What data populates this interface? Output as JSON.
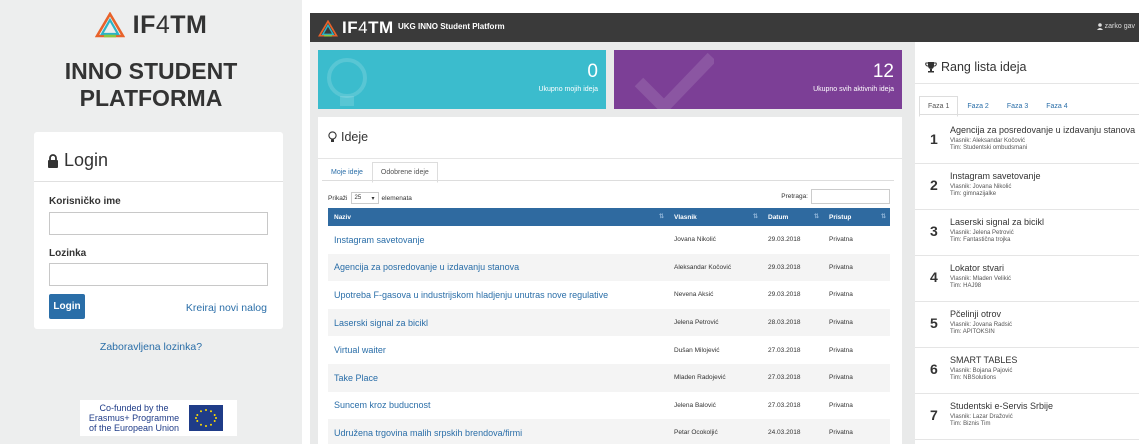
{
  "brand": {
    "logo_text_a": "IF",
    "logo_text_b": "4",
    "logo_text_c": "TM"
  },
  "left": {
    "title_line1": "INNO STUDENT",
    "title_line2": "PLATFORMA",
    "login": {
      "heading": "Login",
      "username_label": "Korisničko ime",
      "username_value": "",
      "password_label": "Lozinka",
      "password_value": "",
      "submit_label": "Login",
      "register_link": "Kreiraj novi nalog"
    },
    "forgot_link": "Zaboravljena lozinka?",
    "eu_line1": "Co-funded by the",
    "eu_line2": "Erasmus+ Programme",
    "eu_line3": "of the European Union"
  },
  "navbar": {
    "subtitle": "UKG INNO Student Platform",
    "user": "zarko gav"
  },
  "tiles": {
    "my": {
      "number": "0",
      "caption": "Ukupno mojih ideja"
    },
    "all": {
      "number": "12",
      "caption": "Ukupno svih aktivnih ideja"
    }
  },
  "ideas": {
    "heading": "Ideje",
    "tabs": [
      "Moje ideje",
      "Odobrene ideje"
    ],
    "length_prefix": "Prikaži",
    "length_value": "25",
    "length_suffix": "elemenata",
    "search_label": "Pretraga:",
    "search_value": "",
    "columns": [
      "Naziv",
      "Vlasnik",
      "Datum",
      "Pristup"
    ],
    "rows": [
      {
        "name": "Instagram savetovanje",
        "owner": "Jovana Nikolić",
        "date": "29.03.2018",
        "access": "Privatna"
      },
      {
        "name": "Agencija za posredovanje u izdavanju stanova",
        "owner": "Aleksandar Kočović",
        "date": "29.03.2018",
        "access": "Privatna"
      },
      {
        "name": "Upotreba F-gasova u industrijskom hladjenju unutras nove regulative",
        "owner": "Nevena Aksić",
        "date": "29.03.2018",
        "access": "Privatna"
      },
      {
        "name": "Laserski signal za bicikl",
        "owner": "Jelena Petrović",
        "date": "28.03.2018",
        "access": "Privatna"
      },
      {
        "name": "Virtual waiter",
        "owner": "Dušan Milojević",
        "date": "27.03.2018",
        "access": "Privatna"
      },
      {
        "name": "Take Place",
        "owner": "Mladen Radojević",
        "date": "27.03.2018",
        "access": "Privatna"
      },
      {
        "name": "Suncem kroz buducnost",
        "owner": "Jelena Balović",
        "date": "27.03.2018",
        "access": "Privatna"
      },
      {
        "name": "Udružena trgovina malih srpskih brendova/firmi",
        "owner": "Petar Ocokoljić",
        "date": "24.03.2018",
        "access": "Privatna"
      }
    ]
  },
  "ranking": {
    "heading": "Rang lista ideja",
    "tabs": [
      "Faza 1",
      "Faza 2",
      "Faza 3",
      "Faza 4"
    ],
    "items": [
      {
        "rank": "1",
        "title": "Agencija za posredovanje u izdavanju stanova",
        "owner": "Vlasnik: Aleksandar Kočović",
        "team": "Tim: Studentski ombudsmani"
      },
      {
        "rank": "2",
        "title": "Instagram savetovanje",
        "owner": "Vlasnik: Jovana Nikolić",
        "team": "Tim: gimnazijalke"
      },
      {
        "rank": "3",
        "title": "Laserski signal za bicikl",
        "owner": "Vlasnik: Jelena Petrović",
        "team": "Tim: Fantastična trojka"
      },
      {
        "rank": "4",
        "title": "Lokator stvari",
        "owner": "Vlasnik: Mladen Velikić",
        "team": "Tim: HAJ98"
      },
      {
        "rank": "5",
        "title": "Pčelinji otrov",
        "owner": "Vlasnik: Jovana Radsić",
        "team": "Tim: APITOKSIN"
      },
      {
        "rank": "6",
        "title": "SMART TABLES",
        "owner": "Vlasnik: Bojana Pajović",
        "team": "Tim: NBSolutions"
      },
      {
        "rank": "7",
        "title": "Studentski e-Servis Srbije",
        "owner": "Vlasnik: Lazar Dražović",
        "team": "Tim: Biznis Tim"
      }
    ]
  },
  "colors": {
    "teal": "#3bbccd",
    "purple": "#7c3f96",
    "table_header": "#2f6aa0",
    "link": "#2a6ea8",
    "navbar": "#3a3a3a"
  }
}
